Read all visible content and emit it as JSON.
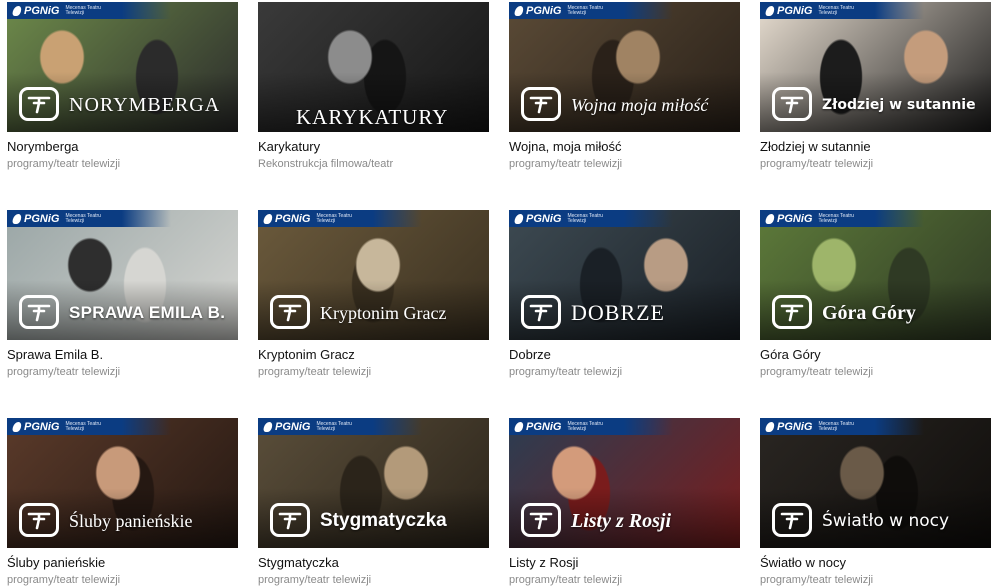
{
  "sponsor": {
    "brand": "PGNiG",
    "patron_text": "Mecenas Teatru Telewizji"
  },
  "cards": [
    {
      "title": "Norymberga",
      "overlay": "NORYMBERGA",
      "category": "programy/teatr telewizji",
      "sponsored": true,
      "colors": [
        "#6d8a4a",
        "#c9a173",
        "#2b2b2b"
      ]
    },
    {
      "title": "Karykatury",
      "overlay": "KARYKATURY",
      "category": "Rekonstrukcja filmowa/teatr",
      "sponsored": false,
      "colors": [
        "#3a3a3a",
        "#8c8c8c",
        "#151515"
      ]
    },
    {
      "title": "Wojna, moja miłość",
      "overlay": "Wojna moja miłość",
      "category": "programy/teatr telewizji",
      "sponsored": true,
      "colors": [
        "#5a4a36",
        "#a08363",
        "#2a2119"
      ]
    },
    {
      "title": "Złodziej w sutannie",
      "overlay": "Złodziej w sutannie",
      "category": "programy/teatr telewizji",
      "sponsored": true,
      "colors": [
        "#e7ddd0",
        "#c49c7c",
        "#1c1c1c"
      ]
    },
    {
      "title": "Sprawa Emila B.",
      "overlay": "SPRAWA EMILA B.",
      "category": "programy/teatr telewizji",
      "sponsored": true,
      "colors": [
        "#9aa6a6",
        "#2e2e2e",
        "#d6d6d2"
      ]
    },
    {
      "title": "Kryptonim Gracz",
      "overlay": "Kryptonim Gracz",
      "category": "programy/teatr telewizji",
      "sponsored": true,
      "colors": [
        "#6b5a3c",
        "#c7b79b",
        "#3a3020"
      ]
    },
    {
      "title": "Dobrze",
      "overlay": "DOBRZE",
      "category": "programy/teatr telewizji",
      "sponsored": true,
      "colors": [
        "#3d4a52",
        "#b89c84",
        "#1a2026"
      ]
    },
    {
      "title": "Góra Góry",
      "overlay": "Góra Góry",
      "category": "programy/teatr telewizji",
      "sponsored": true,
      "colors": [
        "#5d7a3a",
        "#9eb56a",
        "#2f3a24"
      ]
    },
    {
      "title": "Śluby panieńskie",
      "overlay": "Śluby panieńskie",
      "category": "programy/teatr telewizji",
      "sponsored": true,
      "colors": [
        "#5a3a2a",
        "#c89a7a",
        "#251812"
      ]
    },
    {
      "title": "Stygmatyczka",
      "overlay": "Stygmatyczka",
      "category": "programy/teatr telewizji",
      "sponsored": true,
      "colors": [
        "#5a4e3a",
        "#b39a7a",
        "#2b241a"
      ]
    },
    {
      "title": "Listy z Rosji",
      "overlay": "Listy z Rosji",
      "category": "programy/teatr telewizji",
      "sponsored": true,
      "colors": [
        "#2b3d52",
        "#d39b7b",
        "#7a1c1c"
      ]
    },
    {
      "title": "Światło w nocy",
      "overlay": "Światło w nocy",
      "category": "programy/teatr telewizji",
      "sponsored": true,
      "colors": [
        "#2a2622",
        "#6a5a48",
        "#0f0d0b"
      ]
    }
  ]
}
